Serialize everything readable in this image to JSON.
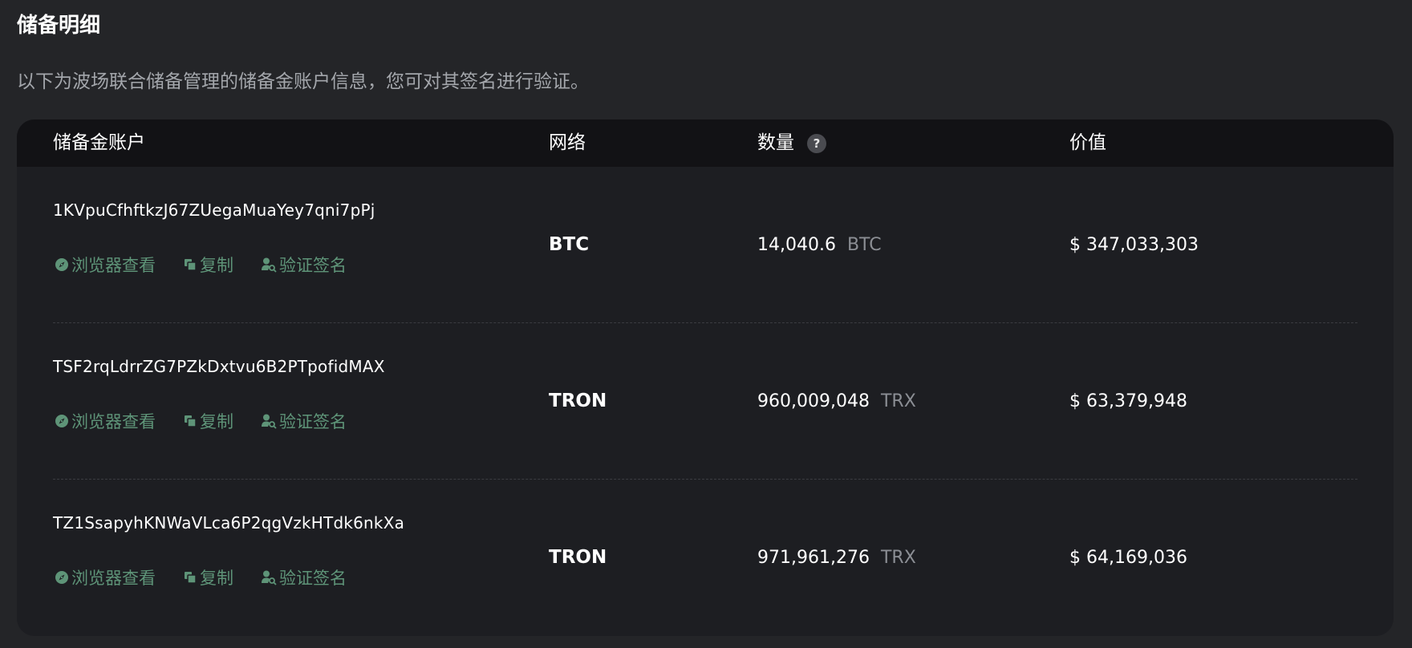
{
  "page": {
    "title": "储备明细",
    "description": "以下为波场联合储备管理的储备金账户信息，您可对其签名进行验证。"
  },
  "colors": {
    "background": "#242528",
    "card": "#1d1e22",
    "header": "#121215",
    "action_green": "#5e9478",
    "muted": "#8b8e94"
  },
  "table": {
    "headers": {
      "account": "储备金账户",
      "network": "网络",
      "amount": "数量",
      "amount_help": "?",
      "value": "价值"
    },
    "action_labels": {
      "explorer": "浏览器查看",
      "copy": "复制",
      "verify": "验证签名"
    },
    "icons": {
      "explorer": "compass-icon",
      "copy": "copy-icon",
      "verify": "user-search-icon",
      "help": "question-icon"
    },
    "rows": [
      {
        "address": "1KVpuCfhftkzJ67ZUegaMuaYey7qni7pPj",
        "network": "BTC",
        "amount": "14,040.6",
        "unit": "BTC",
        "value": "$ 347,033,303"
      },
      {
        "address": "TSF2rqLdrrZG7PZkDxtvu6B2PTpofidMAX",
        "network": "TRON",
        "amount": "960,009,048",
        "unit": "TRX",
        "value": "$ 63,379,948"
      },
      {
        "address": "TZ1SsapyhKNWaVLca6P2qgVzkHTdk6nkXa",
        "network": "TRON",
        "amount": "971,961,276",
        "unit": "TRX",
        "value": "$ 64,169,036"
      }
    ]
  }
}
